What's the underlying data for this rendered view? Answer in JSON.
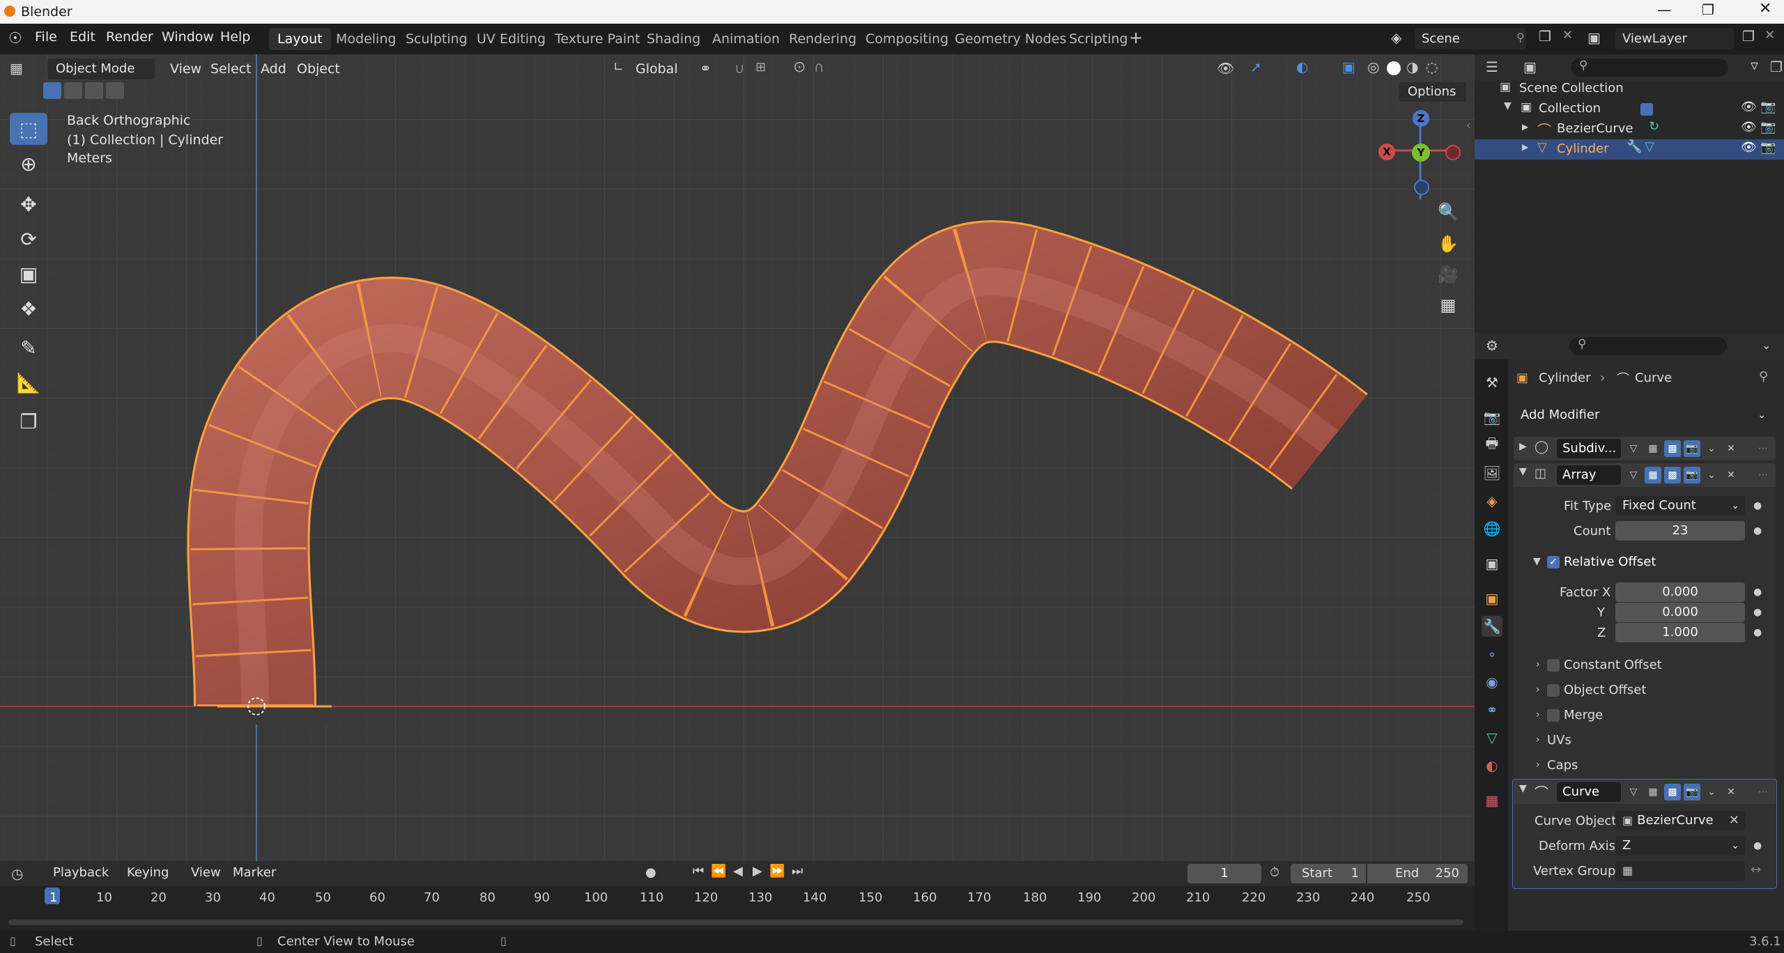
{
  "app": {
    "title": "Blender",
    "version": "3.6.1"
  },
  "menu": [
    "File",
    "Edit",
    "Render",
    "Window",
    "Help"
  ],
  "workspaces": [
    "Layout",
    "Modeling",
    "Sculpting",
    "UV Editing",
    "Texture Paint",
    "Shading",
    "Animation",
    "Rendering",
    "Compositing",
    "Geometry Nodes",
    "Scripting"
  ],
  "scene": "Scene",
  "view_layer": "ViewLayer",
  "viewport": {
    "mode": "Object Mode",
    "menus": [
      "View",
      "Select",
      "Add",
      "Object"
    ],
    "transform": "Global",
    "options": "Options",
    "info_view": "Back Orthographic",
    "info_collection": "(1) Collection | Cylinder",
    "info_units": "Meters",
    "gizmo": {
      "x": "X",
      "y": "Y",
      "z": "Z"
    }
  },
  "outliner": {
    "scene_collection": "Scene Collection",
    "collection": "Collection",
    "items": [
      {
        "name": "BezierCurve"
      },
      {
        "name": "Cylinder"
      }
    ]
  },
  "properties": {
    "breadcrumb_object": "Cylinder",
    "breadcrumb_data": "Curve",
    "add_modifier": "Add Modifier",
    "modifiers": {
      "subdiv": {
        "name": "Subdiv..."
      },
      "array": {
        "name": "Array",
        "fit_type_label": "Fit Type",
        "fit_type": "Fixed Count",
        "count_label": "Count",
        "count": "23",
        "relative_offset": "Relative Offset",
        "factor_x_label": "Factor X",
        "factor_x": "0.000",
        "y_label": "Y",
        "factor_y": "0.000",
        "z_label": "Z",
        "factor_z": "1.000",
        "constant_offset": "Constant Offset",
        "object_offset": "Object Offset",
        "merge": "Merge",
        "uvs": "UVs",
        "caps": "Caps"
      },
      "curve": {
        "name": "Curve",
        "curve_object_label": "Curve Object",
        "curve_object": "BezierCurve",
        "deform_axis_label": "Deform Axis",
        "deform_axis": "Z",
        "vertex_group_label": "Vertex Group"
      }
    }
  },
  "timeline": {
    "menus": [
      "Playback",
      "Keying",
      "View",
      "Marker"
    ],
    "current_frame": "1",
    "start_label": "Start",
    "start": "1",
    "end_label": "End",
    "end": "250",
    "ruler": [
      "1",
      "10",
      "20",
      "30",
      "40",
      "50",
      "60",
      "70",
      "80",
      "90",
      "100",
      "110",
      "120",
      "130",
      "140",
      "150",
      "160",
      "170",
      "180",
      "190",
      "200",
      "210",
      "220",
      "230",
      "240",
      "250"
    ]
  },
  "status": {
    "left": "Select",
    "center": "Center View to Mouse"
  },
  "colors": {
    "accent": "#4772b3",
    "selection": "#ffa13d",
    "tube": "#9c4a3d",
    "viewport_bg": "#393939"
  }
}
